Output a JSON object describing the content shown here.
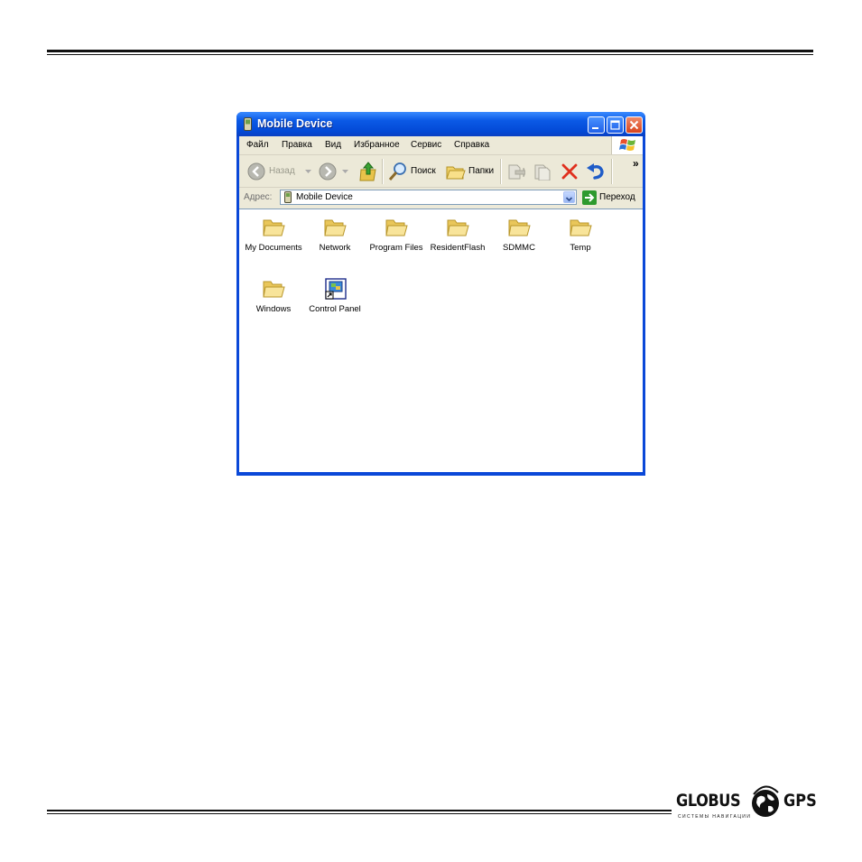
{
  "window": {
    "title": "Mobile Device",
    "title_bar_color": "#0349d6",
    "close_button_color": "#d8431c"
  },
  "menu": {
    "items": [
      "Файл",
      "Правка",
      "Вид",
      "Избранное",
      "Сервис",
      "Справка"
    ]
  },
  "toolbar": {
    "back_label": "Назад",
    "search_label": "Поиск",
    "folders_label": "Папки",
    "overflow_glyph": "»"
  },
  "address": {
    "label": "Адрес:",
    "value": "Mobile Device",
    "go_label": "Переход"
  },
  "files": [
    {
      "name": "My Documents",
      "icon": "folder-icon"
    },
    {
      "name": "Network",
      "icon": "folder-icon"
    },
    {
      "name": "Program Files",
      "icon": "folder-icon"
    },
    {
      "name": "ResidentFlash",
      "icon": "folder-icon"
    },
    {
      "name": "SDMMC",
      "icon": "folder-icon"
    },
    {
      "name": "Temp",
      "icon": "folder-icon"
    },
    {
      "name": "Windows",
      "icon": "folder-icon"
    },
    {
      "name": "Control Panel",
      "icon": "control-panel-shortcut-icon"
    }
  ],
  "logo": {
    "name_left": "GLOBUS",
    "name_right": "GPS",
    "tagline": "СИСТЕМЫ НАВИГАЦИИ"
  }
}
